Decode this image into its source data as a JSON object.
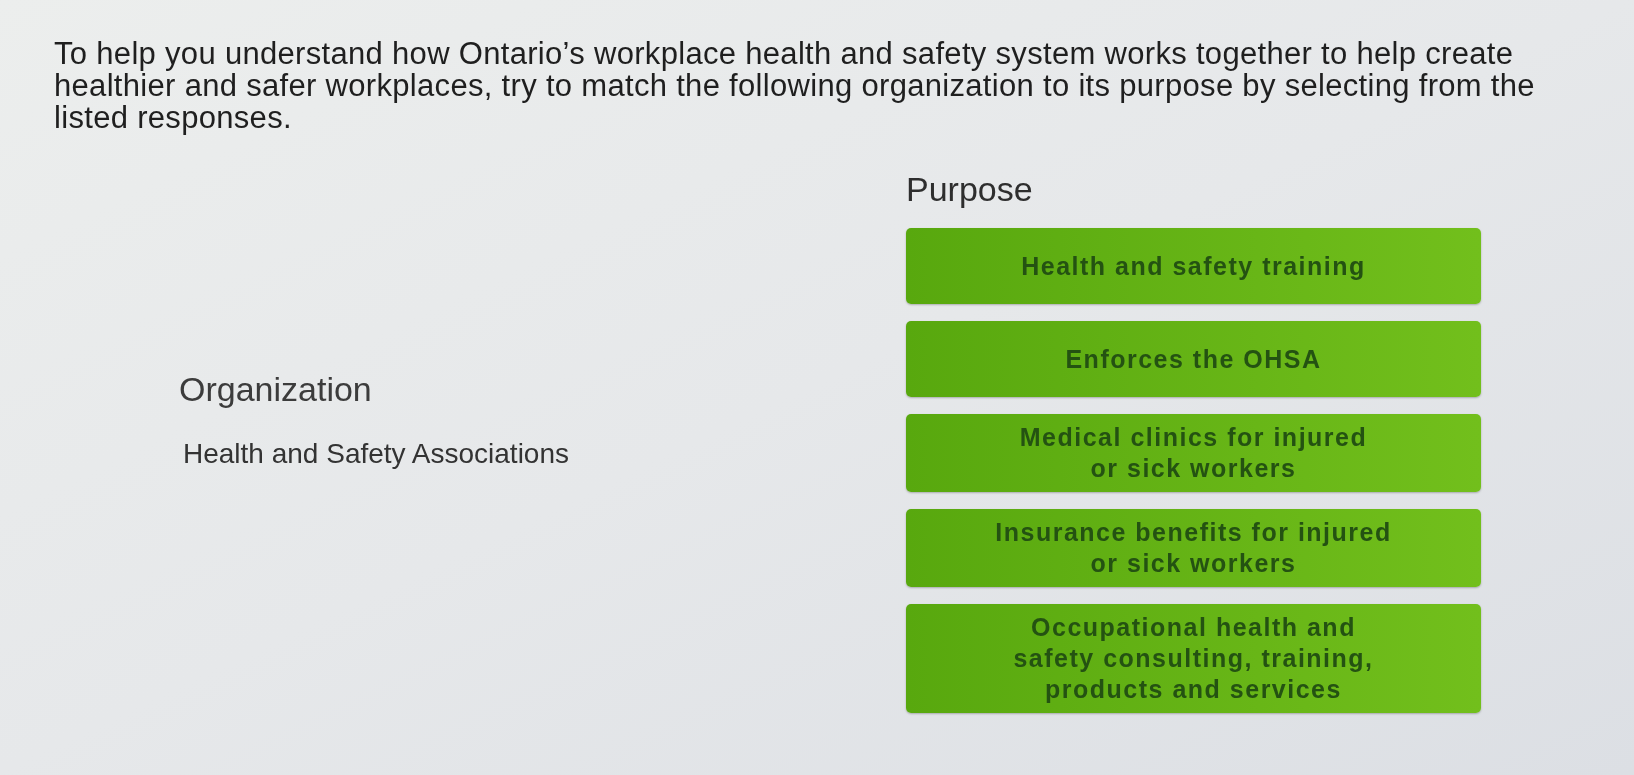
{
  "instructions": "To help you understand how Ontario’s workplace health and safety system works together to help create\nhealthier and safer workplaces, try to match the following organization to its purpose by selecting from the\nlisted responses.",
  "organization": {
    "heading": "Organization",
    "items": [
      "Health and Safety Associations"
    ]
  },
  "purpose": {
    "heading": "Purpose",
    "options": [
      "Health and safety training",
      "Enforces the OHSA",
      "Medical clinics for injured\nor sick workers",
      "Insurance benefits for injured\nor sick workers",
      "Occupational health and\nsafety consulting, training,\nproducts and services"
    ]
  }
}
